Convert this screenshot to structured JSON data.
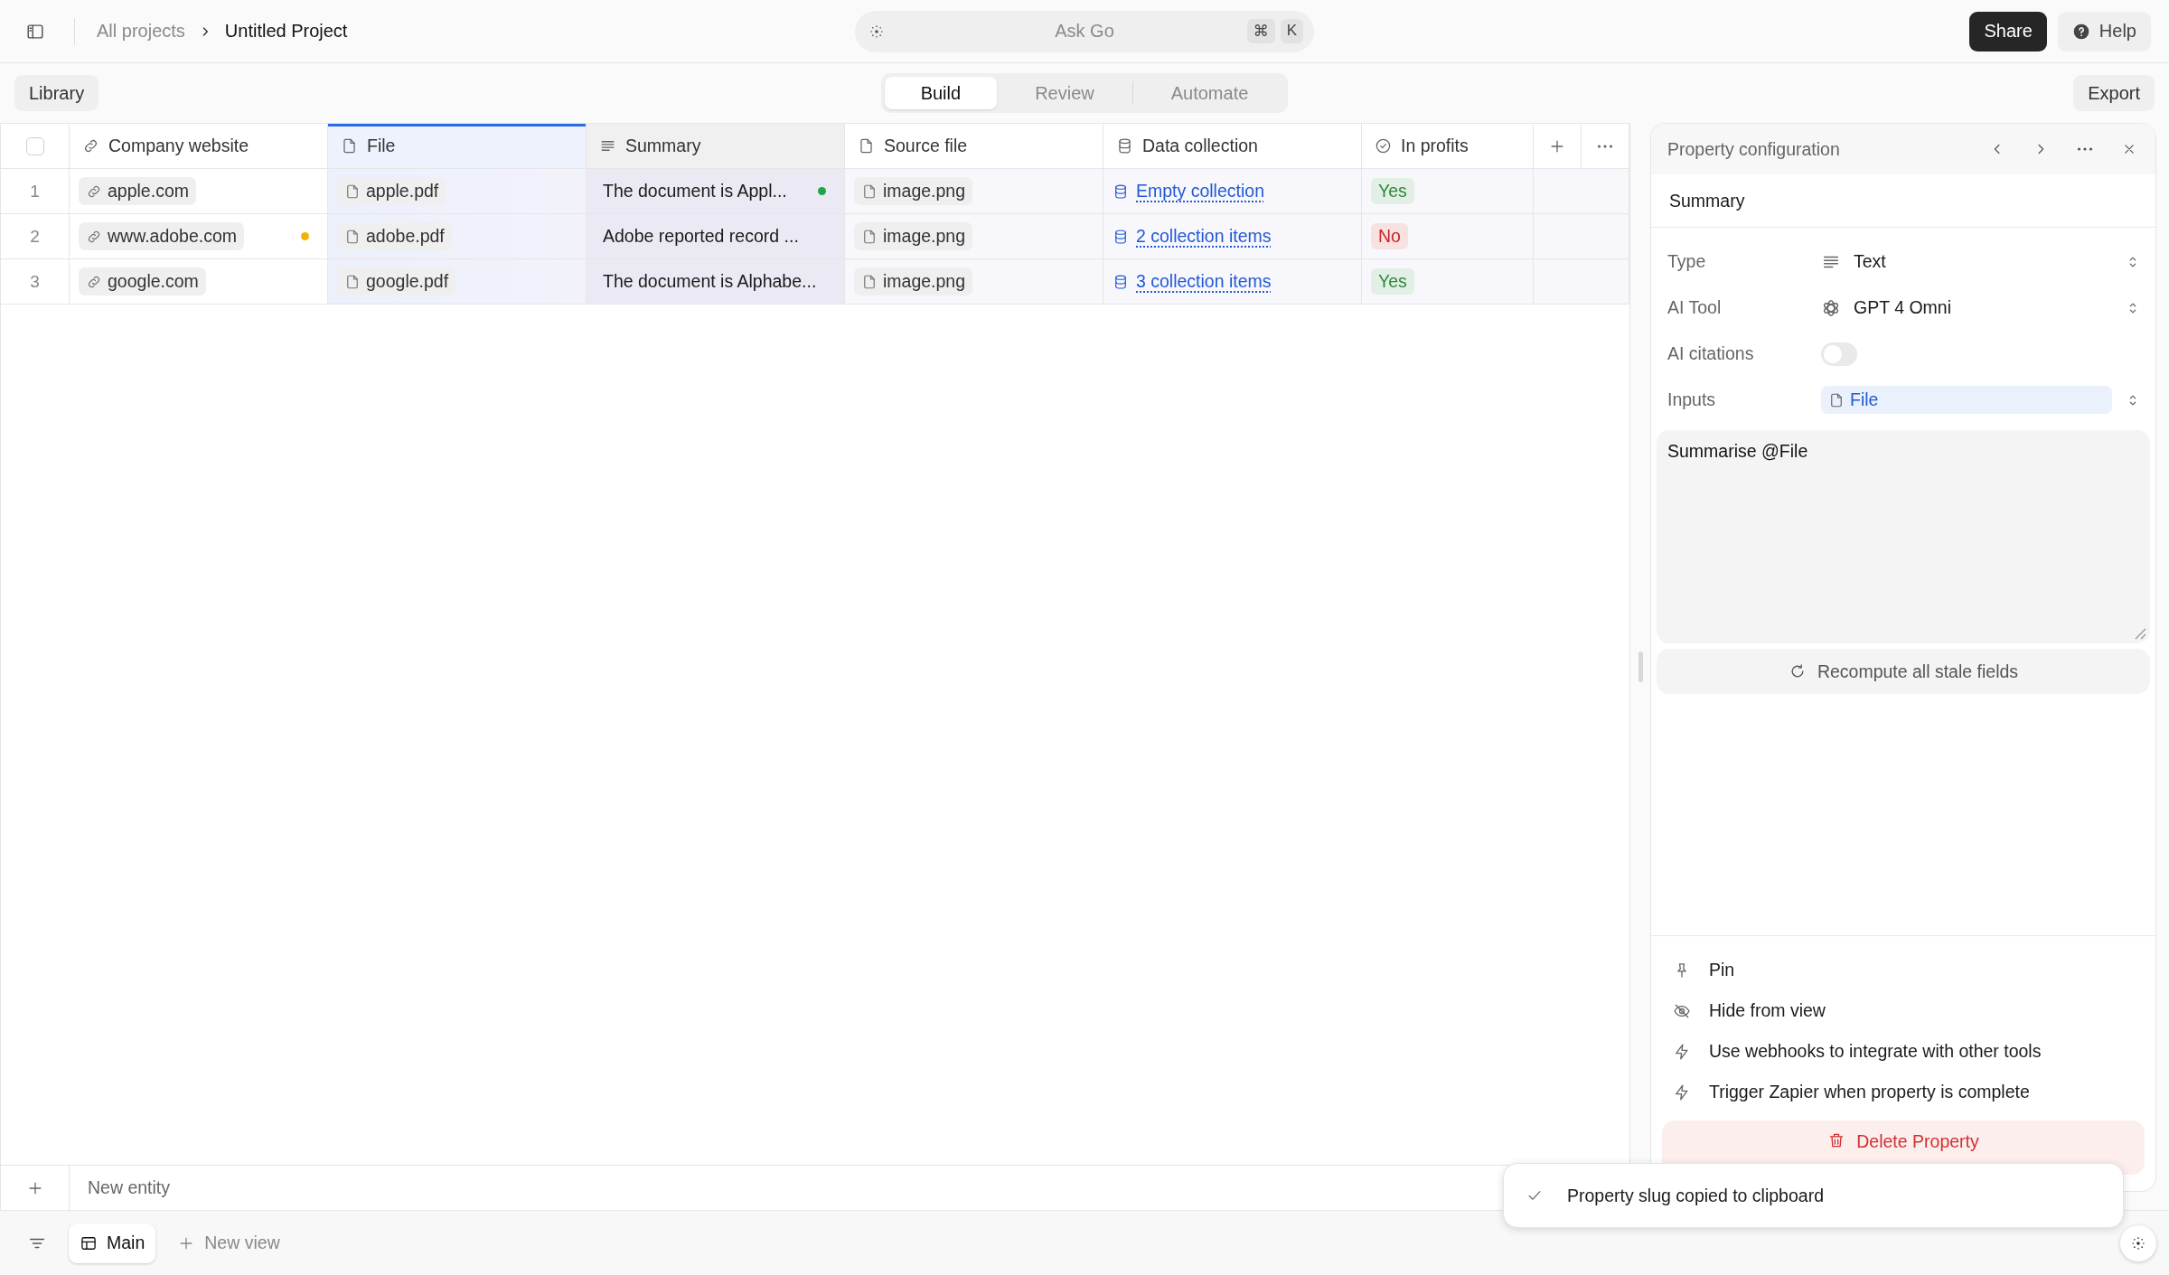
{
  "topbar": {
    "breadcrumb": [
      {
        "label": "All projects",
        "current": false
      },
      {
        "label": "Untitled Project",
        "current": true
      }
    ],
    "search": {
      "placeholder": "Ask Go",
      "shortcut": [
        "⌘",
        "K"
      ]
    },
    "share_button": "Share",
    "help_button": "Help"
  },
  "toolbar": {
    "library_button": "Library",
    "tabs": [
      {
        "label": "Build",
        "selected": true
      },
      {
        "label": "Review",
        "selected": false
      },
      {
        "label": "Automate",
        "selected": false
      }
    ],
    "export_button": "Export"
  },
  "table": {
    "select_all": {
      "checked": false
    },
    "columns": [
      {
        "label": "Company website",
        "kind": "url",
        "selected": false,
        "referenced": false
      },
      {
        "label": "File",
        "kind": "file",
        "selected": false,
        "referenced": true
      },
      {
        "label": "Summary",
        "kind": "text",
        "selected": true,
        "referenced": false
      },
      {
        "label": "Source file",
        "kind": "file",
        "selected": false,
        "referenced": false
      },
      {
        "label": "Data collection",
        "kind": "collection",
        "selected": false,
        "referenced": false
      },
      {
        "label": "In profits",
        "kind": "check",
        "selected": false,
        "referenced": false
      }
    ],
    "rows": [
      {
        "number": "1",
        "cells": [
          {
            "kind": "link",
            "text": "apple.com"
          },
          {
            "kind": "file",
            "text": "apple.pdf"
          },
          {
            "kind": "text",
            "text": "The document is Appl...",
            "dot": {
              "color": "#22a447"
            }
          },
          {
            "kind": "file",
            "text": "image.png"
          },
          {
            "kind": "collection",
            "text": "Empty collection"
          },
          {
            "kind": "tag",
            "text": "Yes",
            "color": "#2f8a3c"
          }
        ]
      },
      {
        "number": "2",
        "cells": [
          {
            "kind": "link",
            "text": "www.adobe.com",
            "dot": {
              "color": "#f0b400"
            }
          },
          {
            "kind": "file",
            "text": "adobe.pdf"
          },
          {
            "kind": "text",
            "text": "Adobe reported record ..."
          },
          {
            "kind": "file",
            "text": "image.png"
          },
          {
            "kind": "collection",
            "text": "2 collection items"
          },
          {
            "kind": "tag",
            "text": "No",
            "color": "#c62828"
          }
        ]
      },
      {
        "number": "3",
        "cells": [
          {
            "kind": "link",
            "text": "google.com"
          },
          {
            "kind": "file",
            "text": "google.pdf"
          },
          {
            "kind": "text",
            "text": "The document is Alphabe..."
          },
          {
            "kind": "file",
            "text": "image.png"
          },
          {
            "kind": "collection",
            "text": "3 collection items"
          },
          {
            "kind": "tag",
            "text": "Yes",
            "color": "#2f8a3c"
          }
        ]
      }
    ]
  },
  "panel": {
    "title": "Property configuration",
    "name": "Summary",
    "fields": [
      {
        "label": "Type",
        "kind": "type-select",
        "value": "Text"
      },
      {
        "label": "AI Tool",
        "kind": "model-select",
        "value": "GPT 4 Omni"
      },
      {
        "label": "AI citations",
        "kind": "toggle",
        "on": false
      },
      {
        "label": "Inputs",
        "kind": "chips",
        "chips": [
          "File"
        ]
      }
    ],
    "prompt": "Summarise @File",
    "recompute_button": "Recompute all stale fields",
    "actions": [
      {
        "label": "Pin",
        "kind": "pin"
      },
      {
        "label": "Hide from view",
        "kind": "hide"
      },
      {
        "label": "Use webhooks to integrate with other tools",
        "kind": "webhook"
      },
      {
        "label": "Trigger Zapier when property is complete",
        "kind": "zapier"
      }
    ],
    "delete_button": "Delete Property"
  },
  "footer": {
    "new_entity": "New entity",
    "views": [
      {
        "label": "Main",
        "selected": true
      }
    ],
    "new_view": "New view"
  },
  "toast": {
    "message": "Property slug copied to clipboard"
  }
}
